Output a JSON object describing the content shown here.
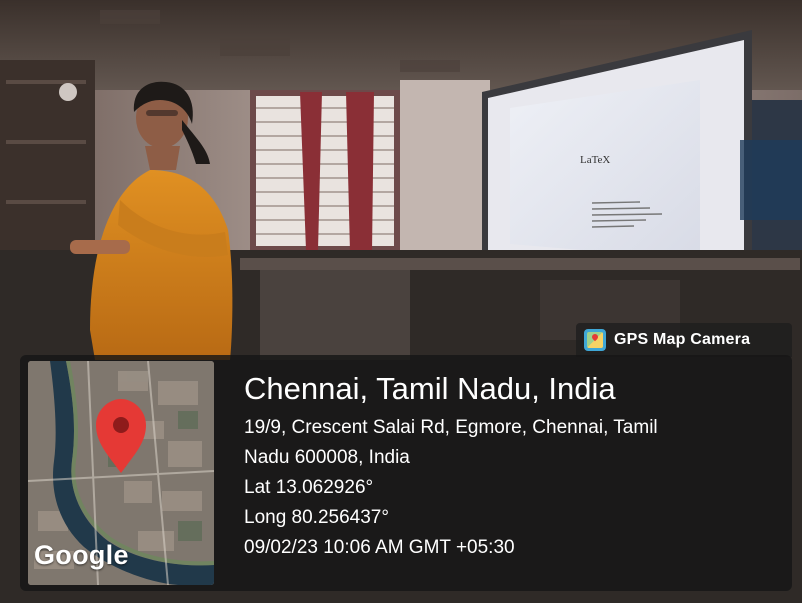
{
  "app_badge": {
    "icon": "gps-map-camera-icon",
    "label": "GPS Map Camera"
  },
  "location": {
    "title": "Chennai, Tamil Nadu, India",
    "address_line1": "19/9, Crescent Salai Rd, Egmore, Chennai, Tamil",
    "address_line2": "Nadu 600008, India",
    "latitude": "Lat 13.062926°",
    "longitude": "Long 80.256437°",
    "timestamp": "09/02/23 10:06 AM GMT +05:30"
  },
  "map": {
    "logo_text": "Google",
    "pin_icon": "map-pin-icon",
    "pin_color": "#e53935"
  },
  "slide": {
    "title": "LaTeX"
  }
}
